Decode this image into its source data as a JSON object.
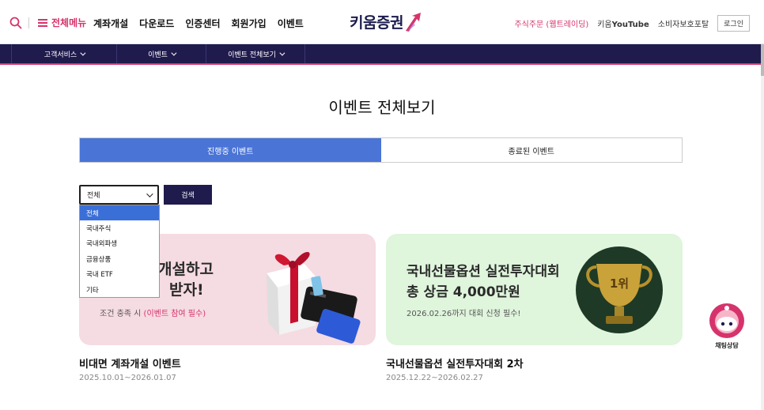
{
  "header": {
    "menu_all": "전체메뉴",
    "gnb": [
      "계좌개설",
      "다운로드",
      "인증센터",
      "회원가입",
      "이벤트"
    ],
    "logo_text": "키움증권",
    "util": {
      "order": "주식주문 (웹트레이딩)",
      "youtube_prefix": "키움",
      "youtube_suffix": "YouTube",
      "consumer": "소비자보호포탈",
      "login": "로그인"
    }
  },
  "subnav": {
    "items": [
      "고객서비스",
      "이벤트",
      "이벤트 전체보기"
    ]
  },
  "page": {
    "title": "이벤트 전체보기"
  },
  "tabs": {
    "active": "진행중 이벤트",
    "inactive": "종료된 이벤트"
  },
  "filter": {
    "selected": "전체",
    "search_label": "검색",
    "options": [
      "전체",
      "국내주식",
      "국내외파생",
      "금융상품",
      "국내 ETF",
      "기타"
    ]
  },
  "cards": [
    {
      "banner_line1": "개설하고",
      "banner_line2": "받자!",
      "banner_sub_prefix": "조건 충족 시 ",
      "banner_sub_highlight": "(이벤트 참여 필수)",
      "title": "비대면 계좌개설 이벤트",
      "date": "2025.10.01~2026.01.07"
    },
    {
      "banner_line1": "국내선물옵션 실전투자대회",
      "banner_line2": "총 상금 4,000만원",
      "banner_sub": "2026.02.26까지 대회 신청 필수!",
      "trophy_text": "1위",
      "title": "국내선물옵션 실전투자대회 2차",
      "date": "2025.12.22~2026.02.27"
    }
  ],
  "chatbot": {
    "label": "채팅상담"
  },
  "colors": {
    "brand_pink": "#d6336c",
    "navy": "#1f1b4d",
    "tab_active": "#4a74d6",
    "card1_bg": "#f5dbe2",
    "card2_bg": "#dff5dc"
  }
}
